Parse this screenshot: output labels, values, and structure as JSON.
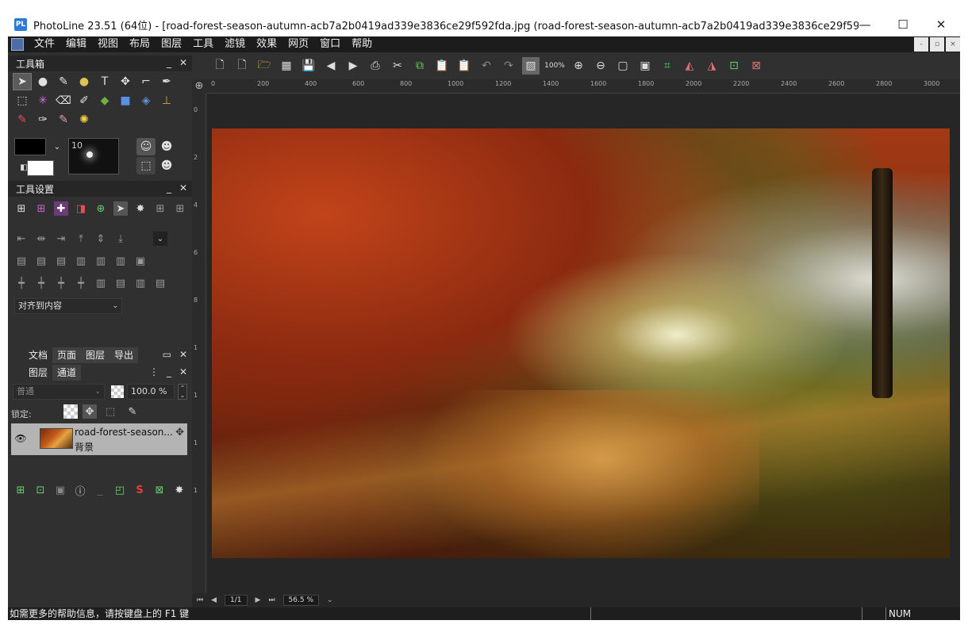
{
  "window": {
    "title": "PhotoLine 23.51 (64位) - [road-forest-season-autumn-acb7a2b0419ad339e3836ce29f592fda.jpg (road-forest-season-autumn-acb7a2b0419ad339e3836ce29f592fda, 红绿...",
    "logo_text": "PL",
    "minimize": "—",
    "maximize": "☐",
    "close": "✕"
  },
  "menu": {
    "items": [
      "文件",
      "编辑",
      "视图",
      "布局",
      "图层",
      "工具",
      "滤镜",
      "效果",
      "网页",
      "窗口",
      "帮助"
    ],
    "mdi_buttons": [
      "-",
      "▫",
      "×"
    ]
  },
  "toolbox": {
    "title": "工具箱",
    "min": "_",
    "close": "✕",
    "brush_size": "10"
  },
  "tool_settings": {
    "title": "工具设置",
    "min": "_",
    "close": "✕",
    "align_target": "对齐到内容"
  },
  "doc_panel": {
    "tabs": [
      "文档",
      "页面",
      "图层",
      "导出"
    ],
    "min": "▭",
    "close": "✕"
  },
  "layers_panel": {
    "tabs": [
      "图层",
      "通道"
    ],
    "menu": "⋮",
    "min": "_",
    "close": "✕",
    "blend_mode": "普通",
    "opacity": "100.0 %",
    "lock_label": "锁定:",
    "layer": {
      "name": "road-forest-season...",
      "sub": "背景"
    }
  },
  "ruler": {
    "h_labels": [
      "0",
      "200",
      "400",
      "600",
      "800",
      "1000",
      "1200",
      "1400",
      "1600",
      "1800",
      "2000",
      "2200",
      "2400",
      "2600",
      "2800",
      "3000"
    ],
    "v_labels": [
      "0",
      "2",
      "4",
      "6",
      "8",
      "1",
      "1",
      "1",
      "1"
    ]
  },
  "toolbar": {
    "zoom_button": "100%"
  },
  "nav": {
    "page": "1/1",
    "zoom": "56.5 %"
  },
  "status": {
    "help_text": "如需更多的帮助信息，请按键盘上的 F1 键",
    "num": "NUM"
  }
}
